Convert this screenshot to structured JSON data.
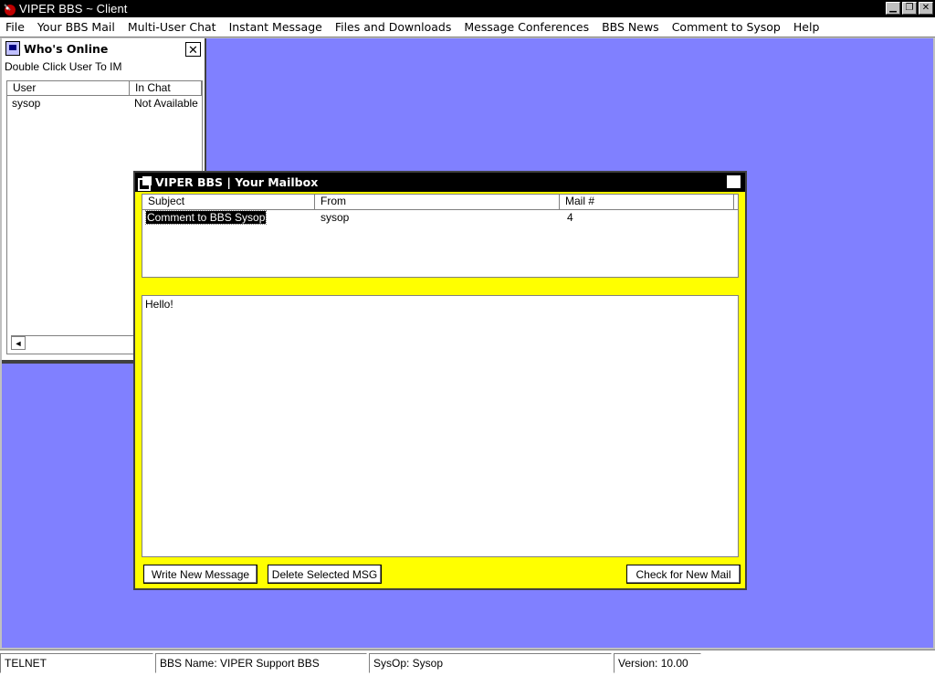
{
  "app": {
    "title": "VIPER BBS ~ Client",
    "controls": {
      "minimize": "▁",
      "restore": "❐",
      "close": "✕"
    }
  },
  "menu": [
    {
      "label": "File"
    },
    {
      "label": "Your BBS Mail"
    },
    {
      "label": "Multi-User Chat"
    },
    {
      "label": "Instant Message"
    },
    {
      "label": "Files and Downloads"
    },
    {
      "label": "Message Conferences"
    },
    {
      "label": "BBS News"
    },
    {
      "label": "Comment to Sysop"
    },
    {
      "label": "Help"
    }
  ],
  "whos_online": {
    "title": "Who's Online",
    "hint": "Double Click User To IM",
    "columns": [
      "User",
      "In Chat"
    ],
    "rows": [
      {
        "user": "sysop",
        "in_chat": "Not Available"
      }
    ],
    "close": "✕",
    "scroll_left": "◄"
  },
  "mailbox": {
    "title": "VIPER BBS | Your Mailbox",
    "close": "✕",
    "columns": [
      "Subject",
      "From",
      "Mail #"
    ],
    "rows": [
      {
        "subject": "Comment to BBS Sysop",
        "from": "sysop",
        "mail_no": "4",
        "selected": true
      }
    ],
    "body": "Hello!",
    "buttons": {
      "write": "Write New Message",
      "delete": "Delete Selected MSG",
      "check": "Check for New Mail"
    },
    "background": "#ffff00"
  },
  "statusbar": {
    "connection": "TELNET",
    "bbs_name": "BBS Name: VIPER Support BBS",
    "sysop": "SysOp: Sysop",
    "version": "Version: 10.00"
  },
  "colors": {
    "desktop": "#8080ff",
    "titlebar": "#000000",
    "accent": "#ffff00"
  }
}
